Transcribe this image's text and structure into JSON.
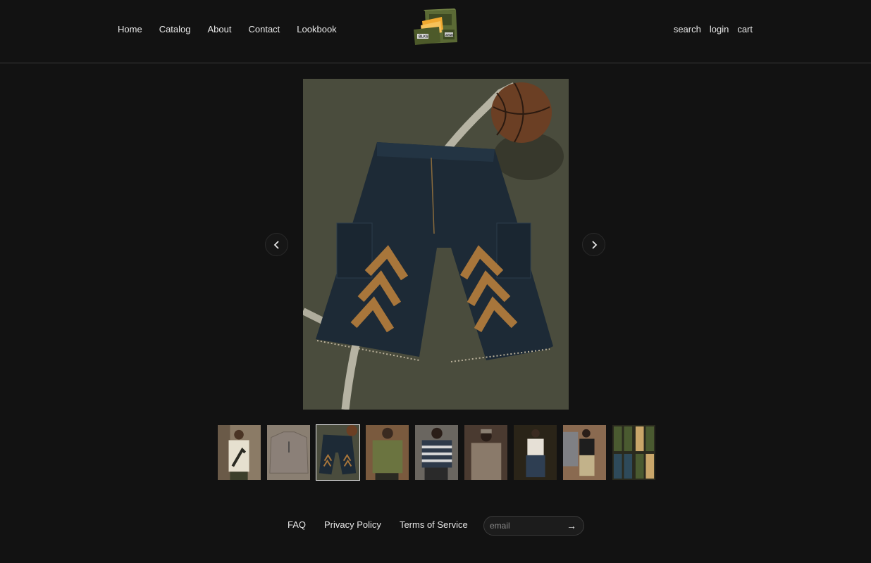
{
  "header": {
    "nav_left": [
      "Home",
      "Catalog",
      "About",
      "Contact",
      "Lookbook"
    ],
    "nav_right": [
      "search",
      "login",
      "cart"
    ],
    "logo_labels": [
      "BLKS",
      "ARMS"
    ]
  },
  "gallery": {
    "prev_icon": "chevron-left-icon",
    "next_icon": "chevron-right-icon",
    "active_index": 2,
    "thumbnail_count": 9
  },
  "footer": {
    "links": [
      "FAQ",
      "Privacy Policy",
      "Terms of Service"
    ],
    "email_placeholder": "email",
    "submit_symbol": "→"
  }
}
